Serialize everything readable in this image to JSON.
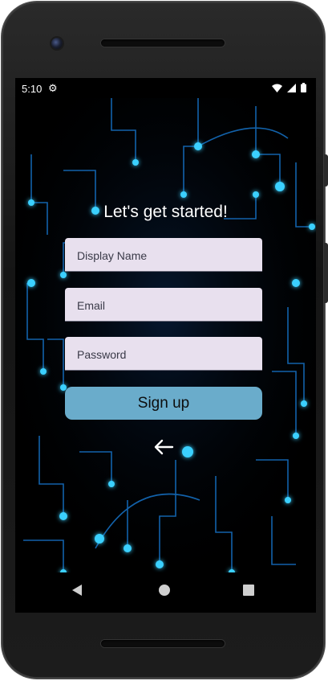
{
  "status_bar": {
    "time": "5:10",
    "icons": [
      "gear-icon",
      "wifi-icon",
      "signal-icon",
      "battery-icon"
    ]
  },
  "signup": {
    "title": "Let's get started!",
    "display_name_placeholder": "Display Name",
    "email_placeholder": "Email",
    "password_placeholder": "Password",
    "button_label": "Sign up",
    "back_icon": "arrow-left-icon"
  },
  "navigation": {
    "icons": [
      "back-triangle-icon",
      "home-circle-icon",
      "recents-square-icon"
    ]
  },
  "colors": {
    "background": "#000000",
    "field": "#e8e0ee",
    "button": "#6aaccb",
    "circuit": "#1aa8ff"
  }
}
